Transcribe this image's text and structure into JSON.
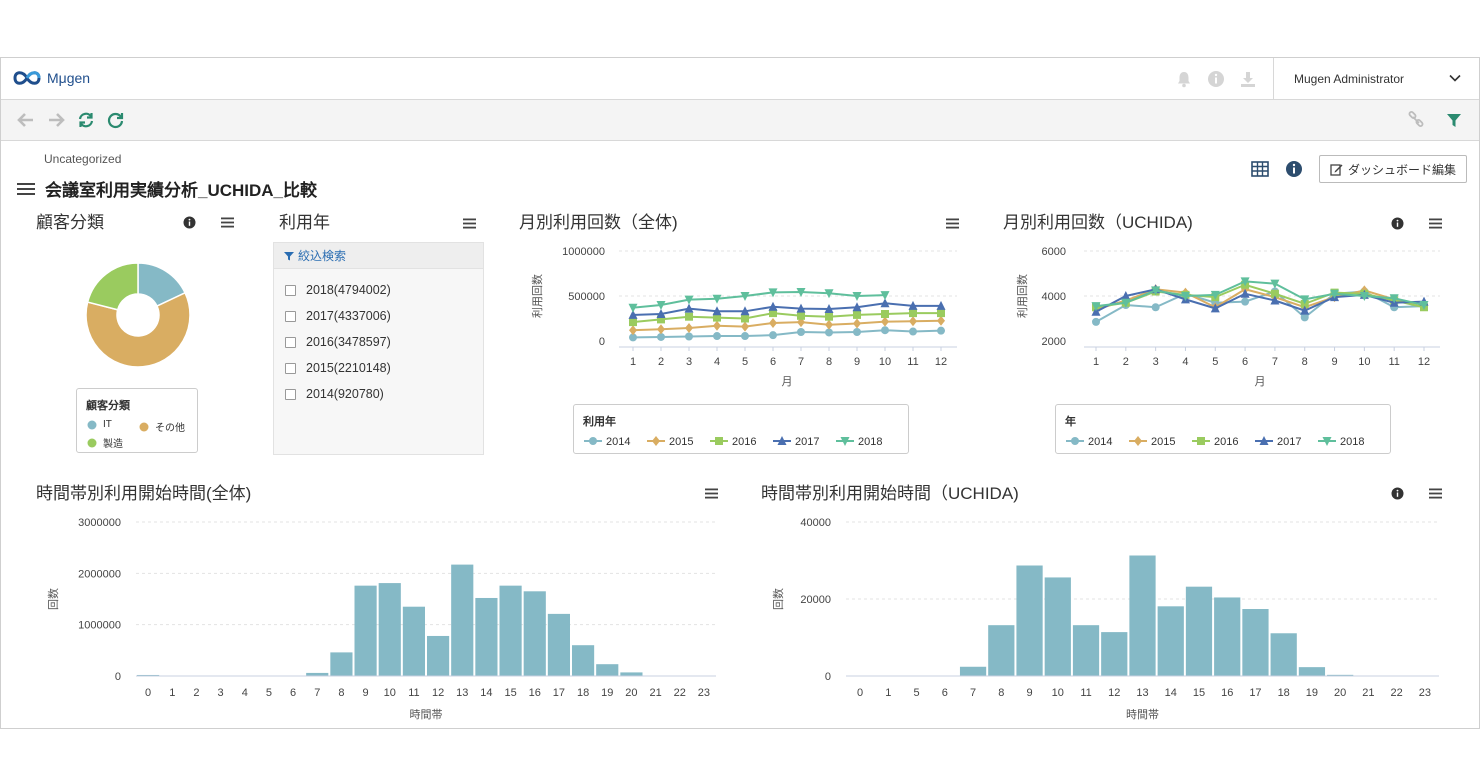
{
  "app": {
    "logo_text": "Mμgen",
    "user_name": "Mugen Administrator"
  },
  "icons": {
    "top": [
      "bell-icon",
      "info-icon",
      "download-icon",
      "chevron-down-icon"
    ],
    "toolbar_left": [
      "arrow-left-icon",
      "arrow-right-icon",
      "sync-icon",
      "refresh-icon"
    ],
    "toolbar_right": [
      "link-icon",
      "filter-icon"
    ]
  },
  "dashboard": {
    "breadcrumb": "Uncategorized",
    "title": "会議室利用実績分析_UCHIDA_比較",
    "edit_label": "ダッシュボード編集"
  },
  "colors": {
    "accent": "#2a6db2",
    "bar": "#85b9c6",
    "series": [
      "#85b9c6",
      "#d9ad62",
      "#9acb5f",
      "#4a6fb0",
      "#5fbf9c"
    ],
    "pie": [
      "#85b9c6",
      "#d9ad62",
      "#9acb5f"
    ]
  },
  "widgets": {
    "customer": {
      "title": "顧客分類",
      "legend_title": "顧客分類",
      "legend": [
        "IT",
        "その他",
        "製造"
      ]
    },
    "year_filter": {
      "title": "利用年",
      "filter_label": "絞込検索",
      "options": [
        "2018(4794002)",
        "2017(4337006)",
        "2016(3478597)",
        "2015(2210148)",
        "2014(920780)"
      ]
    },
    "monthly_all": {
      "title": "月別利用回数（全体)",
      "legend_title": "利用年"
    },
    "monthly_uchida": {
      "title": "月別利用回数（UCHIDA)",
      "legend_title": "年"
    },
    "hourly_all": {
      "title": "時間帯別利用開始時間(全体)"
    },
    "hourly_uchida": {
      "title": "時間帯別利用開始時間（UCHIDA)"
    }
  },
  "chart_data": [
    {
      "type": "pie",
      "categories": [
        "IT",
        "その他",
        "製造"
      ],
      "values": [
        18,
        61,
        21
      ]
    },
    {
      "type": "line",
      "x": [
        1,
        2,
        3,
        4,
        5,
        6,
        7,
        8,
        9,
        10,
        11,
        12
      ],
      "xlabel": "月",
      "ylabel": "利用回数",
      "yticks": [
        "0",
        "500000",
        "1000000"
      ],
      "ylim": [
        0,
        1000000
      ],
      "series": [
        {
          "name": "2014",
          "values": [
            40000,
            45000,
            50000,
            55000,
            55000,
            65000,
            100000,
            95000,
            100000,
            120000,
            105000,
            115000
          ]
        },
        {
          "name": "2015",
          "values": [
            120000,
            130000,
            145000,
            170000,
            160000,
            200000,
            210000,
            180000,
            195000,
            215000,
            220000,
            225000
          ]
        },
        {
          "name": "2016",
          "values": [
            210000,
            240000,
            270000,
            260000,
            250000,
            310000,
            280000,
            270000,
            290000,
            300000,
            310000,
            310000
          ]
        },
        {
          "name": "2017",
          "values": [
            290000,
            300000,
            360000,
            330000,
            330000,
            380000,
            360000,
            355000,
            375000,
            420000,
            390000,
            390000
          ]
        },
        {
          "name": "2018",
          "values": [
            370000,
            400000,
            460000,
            470000,
            500000,
            540000,
            545000,
            530000,
            500000,
            510000,
            null,
            null
          ]
        }
      ]
    },
    {
      "type": "line",
      "x": [
        1,
        2,
        3,
        4,
        5,
        6,
        7,
        8,
        9,
        10,
        11,
        12
      ],
      "xlabel": "月",
      "ylabel": "利用回数",
      "yticks": [
        "2000",
        "4000",
        "6000"
      ],
      "ylim": [
        2000,
        6000
      ],
      "series": [
        {
          "name": "2014",
          "values": [
            2850,
            3600,
            3500,
            4100,
            3700,
            3750,
            4200,
            3050,
            4100,
            4200,
            3500,
            3550
          ]
        },
        {
          "name": "2015",
          "values": [
            3400,
            3800,
            4300,
            4150,
            3500,
            4300,
            3950,
            3500,
            3950,
            4250,
            3850,
            3600
          ]
        },
        {
          "name": "2016",
          "values": [
            3500,
            3700,
            4200,
            4050,
            3950,
            4500,
            4100,
            3650,
            4150,
            4100,
            3800,
            3500
          ]
        },
        {
          "name": "2017",
          "values": [
            3300,
            4000,
            4300,
            3850,
            3450,
            4100,
            3800,
            3350,
            3950,
            4050,
            3700,
            3750
          ]
        },
        {
          "name": "2018",
          "values": [
            3550,
            3700,
            4250,
            4000,
            4050,
            4650,
            4550,
            3850,
            4100,
            4000,
            3900,
            3600
          ]
        }
      ]
    },
    {
      "type": "bar",
      "categories": [
        "0",
        "1",
        "2",
        "3",
        "4",
        "5",
        "6",
        "7",
        "8",
        "9",
        "10",
        "11",
        "12",
        "13",
        "14",
        "15",
        "16",
        "17",
        "18",
        "19",
        "20",
        "21",
        "22",
        "23"
      ],
      "values": [
        20000,
        0,
        0,
        0,
        0,
        0,
        0,
        60000,
        460000,
        1760000,
        1810000,
        1350000,
        780000,
        2170000,
        1520000,
        1760000,
        1650000,
        1210000,
        600000,
        230000,
        70000,
        0,
        0,
        0
      ],
      "xlabel": "時間帯",
      "ylabel": "回数",
      "yticks": [
        "0",
        "1000000",
        "2000000",
        "3000000"
      ],
      "ylim": [
        0,
        3000000
      ]
    },
    {
      "type": "bar",
      "categories": [
        "0",
        "1",
        "5",
        "6",
        "7",
        "8",
        "9",
        "10",
        "11",
        "12",
        "13",
        "14",
        "15",
        "16",
        "17",
        "18",
        "19",
        "20",
        "21",
        "22",
        "23"
      ],
      "values": [
        0,
        0,
        0,
        0,
        2400,
        13200,
        28700,
        25600,
        13200,
        11400,
        31300,
        18100,
        23200,
        20400,
        17400,
        11100,
        2300,
        300,
        0,
        0,
        0
      ],
      "xlabel": "時間帯",
      "ylabel": "回数",
      "yticks": [
        "0",
        "20000",
        "40000"
      ],
      "ylim": [
        0,
        40000
      ]
    }
  ]
}
